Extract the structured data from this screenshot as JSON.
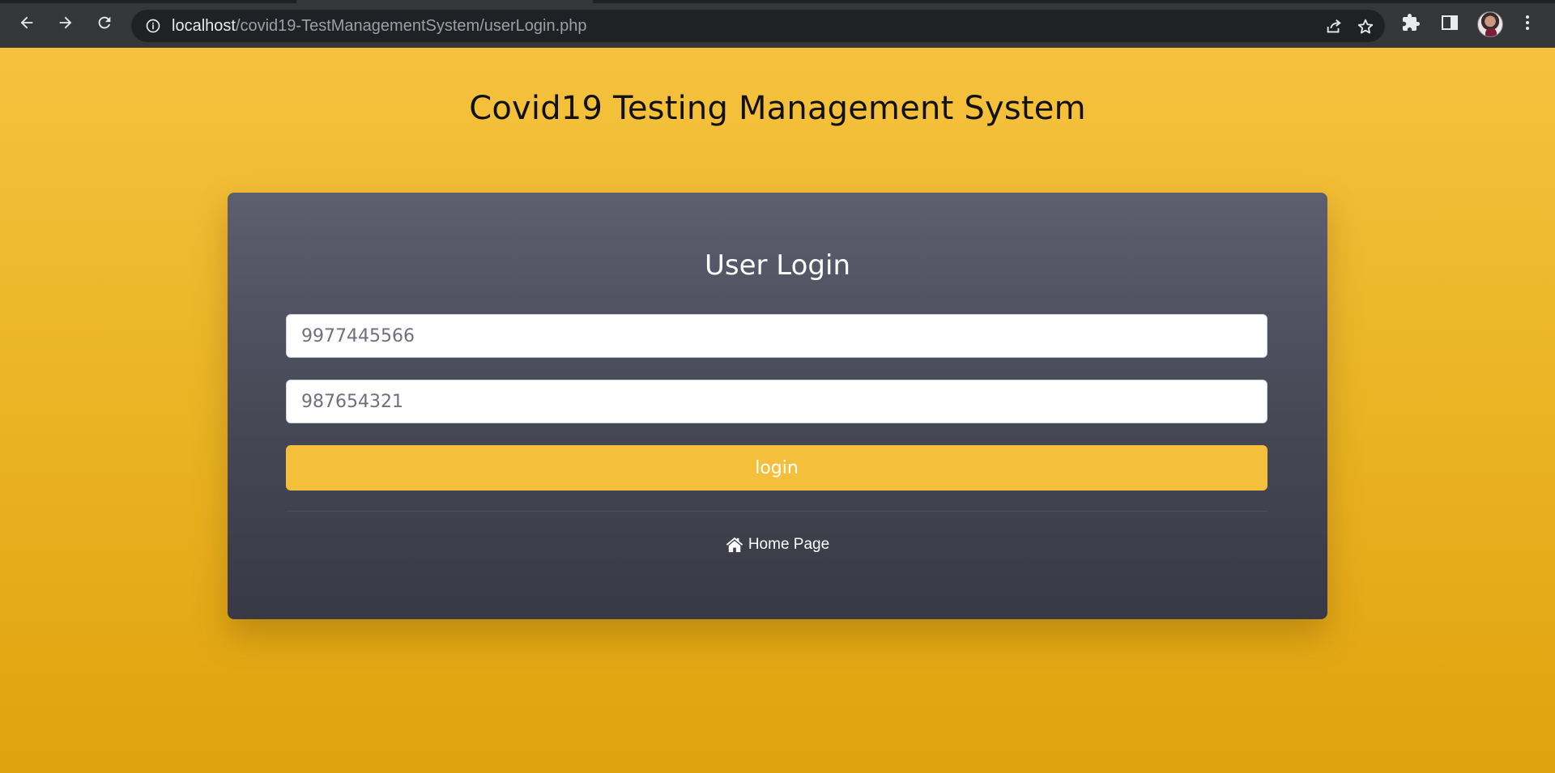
{
  "browser": {
    "url_host": "localhost",
    "url_path": "/covid19-TestManagementSystem/userLogin.php",
    "icons": [
      "back-arrow-icon",
      "forward-arrow-icon",
      "reload-icon",
      "info-icon",
      "share-icon",
      "star-icon",
      "extensions-icon",
      "side-panel-icon",
      "profile-avatar",
      "more-menu-icon"
    ]
  },
  "page": {
    "site_title": "Covid19 Testing Management System",
    "colors": {
      "background": "#f6c23e",
      "card": "#4a4c5a",
      "button": "#f4c03c"
    }
  },
  "login_card": {
    "title": "User Login",
    "mobile_input_value": "9977445566",
    "password_input_value": "987654321",
    "login_button_label": "login",
    "home_link_label": "Home Page",
    "home_icon": "home-icon"
  }
}
